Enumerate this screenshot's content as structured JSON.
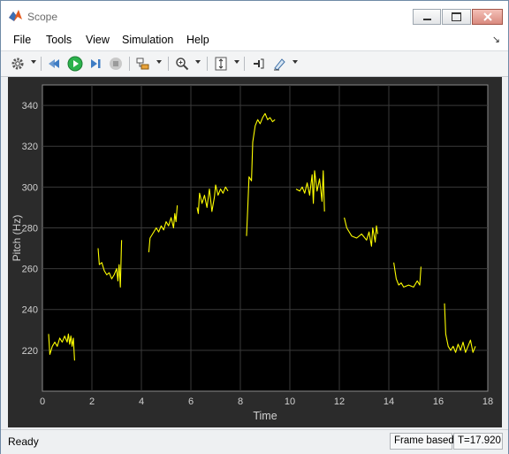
{
  "window": {
    "title": "Scope"
  },
  "menu": [
    "File",
    "Tools",
    "View",
    "Simulation",
    "Help"
  ],
  "toolbar": {
    "icons": [
      "gear-icon",
      "step-back-icon",
      "run-icon",
      "step-forward-icon",
      "stop-icon",
      "signal-select-icon",
      "zoom-icon",
      "autoscale-icon",
      "cursor-icon",
      "highlight-icon"
    ]
  },
  "colors": {
    "trace": "#ffff00",
    "axes_bg": "#000000",
    "figure_bg": "#2b2b2b",
    "run_green": "#2bb24c"
  },
  "chart_data": {
    "type": "line",
    "xlabel": "Time",
    "ylabel": "Pitch (Hz)",
    "xlim": [
      0,
      18
    ],
    "ylim": [
      200,
      350
    ],
    "xticks": [
      0,
      2,
      4,
      6,
      8,
      10,
      12,
      14,
      16,
      18
    ],
    "yticks": [
      220,
      240,
      260,
      280,
      300,
      320,
      340
    ],
    "grid": true,
    "segments": [
      [
        [
          0.25,
          228
        ],
        [
          0.3,
          218
        ],
        [
          0.4,
          222
        ],
        [
          0.5,
          224
        ],
        [
          0.6,
          222
        ],
        [
          0.7,
          226
        ],
        [
          0.8,
          224
        ],
        [
          0.9,
          227
        ],
        [
          1.0,
          224
        ],
        [
          1.05,
          228
        ],
        [
          1.1,
          223
        ],
        [
          1.15,
          227
        ],
        [
          1.2,
          222
        ],
        [
          1.25,
          226
        ],
        [
          1.3,
          215
        ]
      ],
      [
        [
          2.25,
          270
        ],
        [
          2.3,
          262
        ],
        [
          2.4,
          263
        ],
        [
          2.5,
          259
        ],
        [
          2.6,
          257
        ],
        [
          2.7,
          258
        ],
        [
          2.8,
          255
        ],
        [
          2.9,
          257
        ],
        [
          3.0,
          260
        ],
        [
          3.05,
          254
        ],
        [
          3.1,
          262
        ],
        [
          3.15,
          251
        ],
        [
          3.2,
          274
        ]
      ],
      [
        [
          4.3,
          268
        ],
        [
          4.35,
          275
        ],
        [
          4.5,
          278
        ],
        [
          4.6,
          280
        ],
        [
          4.7,
          278
        ],
        [
          4.8,
          281
        ],
        [
          4.9,
          279
        ],
        [
          5.0,
          283
        ],
        [
          5.1,
          281
        ],
        [
          5.2,
          285
        ],
        [
          5.3,
          280
        ],
        [
          5.35,
          287
        ],
        [
          5.4,
          283
        ],
        [
          5.45,
          291
        ]
      ],
      [
        [
          6.25,
          290
        ],
        [
          6.3,
          287
        ],
        [
          6.35,
          297
        ],
        [
          6.45,
          292
        ],
        [
          6.55,
          296
        ],
        [
          6.65,
          290
        ],
        [
          6.75,
          299
        ],
        [
          6.85,
          288
        ],
        [
          6.95,
          295
        ],
        [
          7.0,
          301
        ],
        [
          7.1,
          296
        ],
        [
          7.2,
          299
        ],
        [
          7.3,
          297
        ],
        [
          7.4,
          300
        ],
        [
          7.5,
          298
        ]
      ],
      [
        [
          8.25,
          276
        ],
        [
          8.3,
          290
        ],
        [
          8.35,
          305
        ],
        [
          8.45,
          303
        ],
        [
          8.5,
          322
        ],
        [
          8.6,
          330
        ],
        [
          8.7,
          333
        ],
        [
          8.8,
          331
        ],
        [
          8.9,
          334
        ],
        [
          9.0,
          336
        ],
        [
          9.1,
          333
        ],
        [
          9.2,
          334
        ],
        [
          9.3,
          332
        ],
        [
          9.4,
          333
        ]
      ],
      [
        [
          10.25,
          299
        ],
        [
          10.4,
          298
        ],
        [
          10.5,
          300
        ],
        [
          10.6,
          297
        ],
        [
          10.7,
          302
        ],
        [
          10.8,
          296
        ],
        [
          10.9,
          306
        ],
        [
          10.95,
          292
        ],
        [
          11.0,
          308
        ],
        [
          11.1,
          298
        ],
        [
          11.2,
          304
        ],
        [
          11.3,
          293
        ],
        [
          11.35,
          308
        ],
        [
          11.4,
          288
        ]
      ],
      [
        [
          12.2,
          285
        ],
        [
          12.3,
          280
        ],
        [
          12.4,
          278
        ],
        [
          12.5,
          276
        ],
        [
          12.7,
          275
        ],
        [
          12.9,
          277
        ],
        [
          13.1,
          274
        ],
        [
          13.2,
          278
        ],
        [
          13.3,
          271
        ],
        [
          13.35,
          280
        ],
        [
          13.45,
          273
        ],
        [
          13.5,
          281
        ],
        [
          13.55,
          277
        ]
      ],
      [
        [
          14.2,
          263
        ],
        [
          14.3,
          255
        ],
        [
          14.4,
          252
        ],
        [
          14.5,
          253
        ],
        [
          14.6,
          251
        ],
        [
          14.8,
          252
        ],
        [
          15.0,
          251
        ],
        [
          15.15,
          254
        ],
        [
          15.25,
          252
        ],
        [
          15.3,
          261
        ]
      ],
      [
        [
          16.25,
          243
        ],
        [
          16.3,
          228
        ],
        [
          16.4,
          222
        ],
        [
          16.5,
          220
        ],
        [
          16.6,
          222
        ],
        [
          16.7,
          219
        ],
        [
          16.8,
          223
        ],
        [
          16.9,
          220
        ],
        [
          17.0,
          224
        ],
        [
          17.1,
          219
        ],
        [
          17.2,
          222
        ],
        [
          17.3,
          225
        ],
        [
          17.4,
          219
        ],
        [
          17.5,
          222
        ]
      ]
    ]
  },
  "status": {
    "ready": "Ready",
    "mode": "Frame based",
    "time": "T=17.920"
  }
}
